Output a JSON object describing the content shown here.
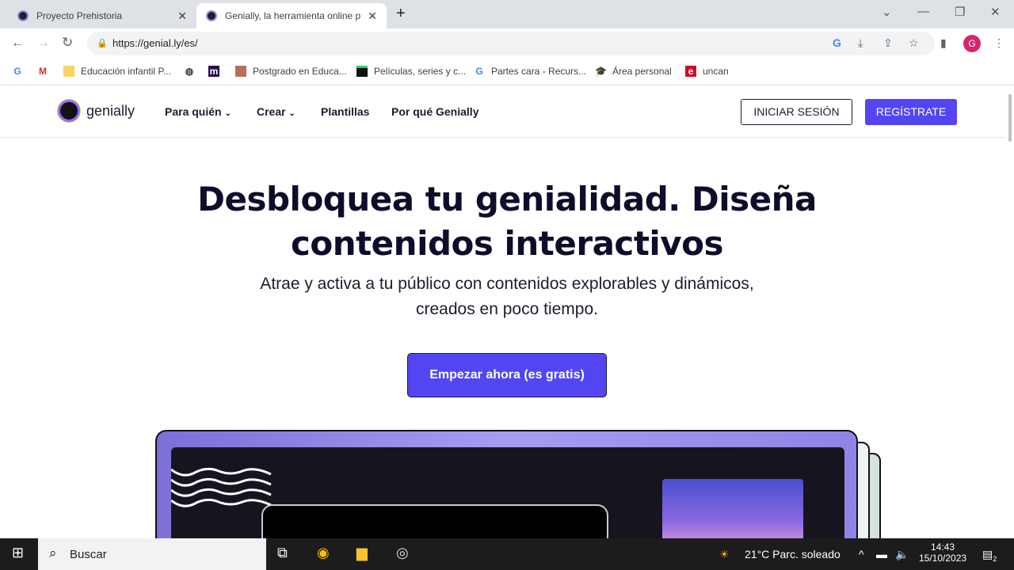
{
  "browser": {
    "tabs": [
      {
        "title": "Proyecto Prehistoria",
        "active": false
      },
      {
        "title": "Genially, la herramienta online p",
        "active": true
      }
    ],
    "url": "https://genial.ly/es/",
    "profile_initial": "G",
    "bookmarks": [
      "Educación infantil P...",
      "Postgrado en Educa...",
      "Películas, series y c...",
      "Partes cara - Recurs...",
      "Área personal",
      "uncan"
    ]
  },
  "site": {
    "logo": "genially",
    "menu": [
      "Para quién",
      "Crear",
      "Plantillas",
      "Por qué Genially"
    ],
    "login": "INICIAR SESIÓN",
    "register": "REGÍSTRATE",
    "headline_1": "Desbloquea tu genialidad. Diseña",
    "headline_2": "contenidos interactivos",
    "sub_1": "Atrae y activa a tu público con contenidos explorables y dinámicos,",
    "sub_2": "creados en poco tiempo.",
    "cta": "Empezar ahora (es gratis)",
    "accent": "#5346f2"
  },
  "taskbar": {
    "search": "Buscar",
    "weather": "21°C  Parc. soleado",
    "time": "14:43",
    "date": "15/10/2023",
    "notifications": "2"
  }
}
